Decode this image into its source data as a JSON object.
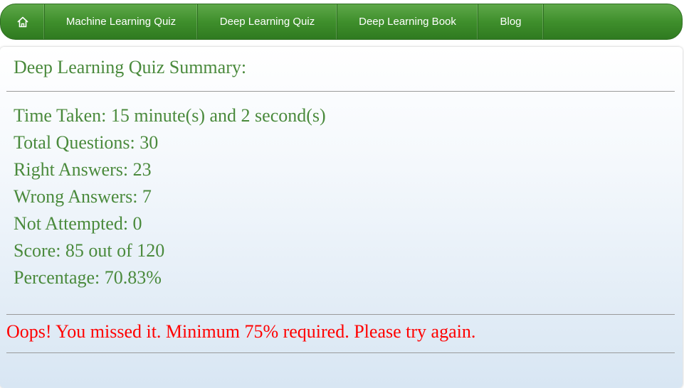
{
  "nav": {
    "home_icon": "home-icon",
    "items": [
      {
        "label": "Machine Learning Quiz"
      },
      {
        "label": "Deep Learning Quiz"
      },
      {
        "label": "Deep Learning Book"
      },
      {
        "label": "Blog"
      }
    ]
  },
  "summary": {
    "title": "Deep Learning Quiz Summary:",
    "time_taken": "Time Taken: 15 minute(s) and 2 second(s)",
    "total_questions": "Total Questions: 30",
    "right_answers": "Right Answers: 23",
    "wrong_answers": "Wrong Answers: 7",
    "not_attempted": "Not Attempted: 0",
    "score": "Score: 85 out of 120",
    "percentage": "Percentage: 70.83%"
  },
  "result": {
    "message": "Oops! You missed it. Minimum 75% required. Please try again."
  },
  "colors": {
    "nav_green": "#3f8f2c",
    "text_green": "#4a8a3c",
    "error_red": "#ff0000"
  }
}
